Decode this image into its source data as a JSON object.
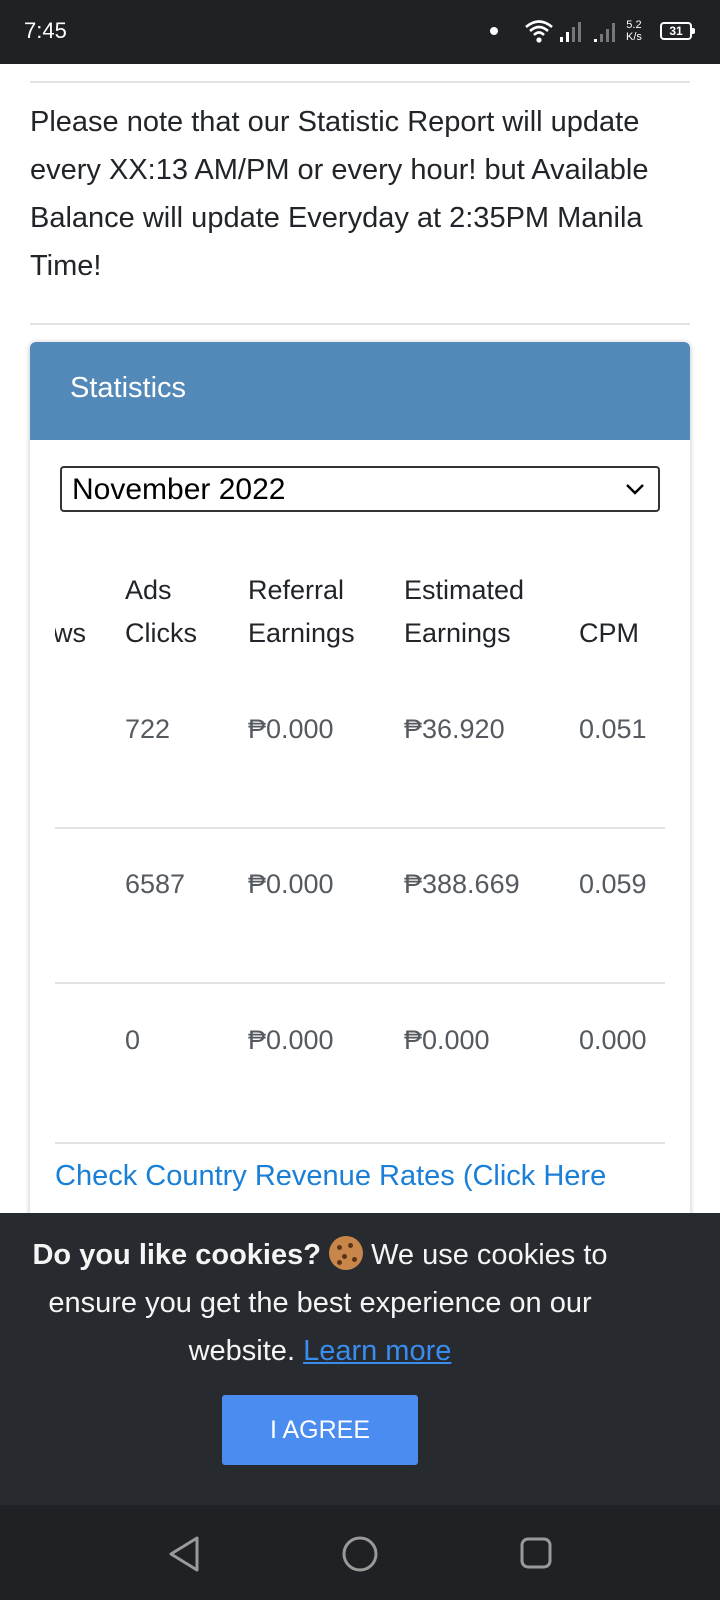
{
  "status_bar": {
    "time": "7:45",
    "speed_value": "5.2",
    "speed_unit": "K/s",
    "battery": "31"
  },
  "notice": "Please note that our Statistic Report will update every XX:13 AM/PM or every hour! but Available Balance will update Everyday at 2:35PM Manila Time!",
  "stats_card": {
    "title": "Statistics",
    "month_select": {
      "value": "November 2022"
    },
    "table": {
      "columns": [
        {
          "line1": "",
          "line2": "ws"
        },
        {
          "line1": "Ads",
          "line2": "Clicks"
        },
        {
          "line1": "Referral",
          "line2": "Earnings"
        },
        {
          "line1": "Estimated",
          "line2": "Earnings"
        },
        {
          "line1": "",
          "line2": "CPM"
        }
      ],
      "rows": [
        {
          "ads_clicks": "722",
          "referral_earnings": "₱0.000",
          "estimated_earnings": "₱36.920",
          "cpm": "0.051"
        },
        {
          "ads_clicks": "6587",
          "referral_earnings": "₱0.000",
          "estimated_earnings": "₱388.669",
          "cpm": "0.059"
        },
        {
          "ads_clicks": "0",
          "referral_earnings": "₱0.000",
          "estimated_earnings": "₱0.000",
          "cpm": "0.000"
        }
      ]
    },
    "country_rates_link": "Check Country Revenue Rates (Click Here"
  },
  "cookie_banner": {
    "heading": "Do you like cookies?",
    "text": " We use cookies to ensure you get the best experience on our website. ",
    "learn_more": "Learn more",
    "agree_button": "I AGREE"
  },
  "icons": {
    "wifi": "wifi-icon",
    "signal": "signal-icon",
    "battery": "battery-icon",
    "cookie": "cookie-emoji-icon",
    "chevron": "chevron-down-icon",
    "back": "back-triangle-icon",
    "home": "home-circle-icon",
    "recent": "recent-square-icon"
  },
  "colors": {
    "header": "#5389b8",
    "link": "#1a7fd6",
    "agree_button": "#4a8cf0",
    "banner": "#272a2e"
  }
}
